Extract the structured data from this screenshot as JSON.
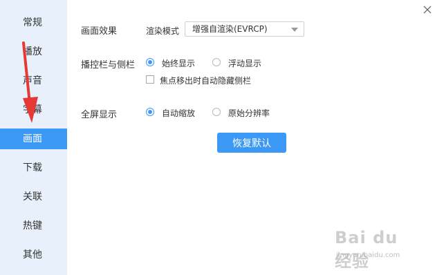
{
  "sidebar": {
    "items": [
      {
        "label": "常规",
        "active": false
      },
      {
        "label": "播放",
        "active": false
      },
      {
        "label": "声音",
        "active": false
      },
      {
        "label": "字幕",
        "active": false
      },
      {
        "label": "画面",
        "active": true
      },
      {
        "label": "下载",
        "active": false
      },
      {
        "label": "关联",
        "active": false
      },
      {
        "label": "热键",
        "active": false
      },
      {
        "label": "其他",
        "active": false
      }
    ]
  },
  "picture_effect": {
    "label": "画面效果",
    "render_mode_label": "渲染模式",
    "render_mode_value": "增强自渲染(EVRCP)"
  },
  "control_bar": {
    "label": "播控栏与侧栏",
    "options": [
      "始终显示",
      "浮动显示"
    ],
    "selected": "始终显示",
    "auto_hide_checkbox_label": "焦点移出时自动隐藏侧栏",
    "auto_hide_checked": false
  },
  "fullscreen": {
    "label": "全屏显示",
    "options": [
      "自动缩放",
      "原始分辨率"
    ],
    "selected": "自动缩放"
  },
  "reset_button_label": "恢复默认",
  "watermark": {
    "main": "Bai du 经验",
    "sub": "jingyan.baidu.com"
  },
  "colors": {
    "accent": "#3c98f5",
    "sidebar_bg": "#e8f1fb",
    "annotation_arrow": "#e53935"
  },
  "icons": {
    "close": "close-icon",
    "dropdown": "chevron-down-icon"
  }
}
